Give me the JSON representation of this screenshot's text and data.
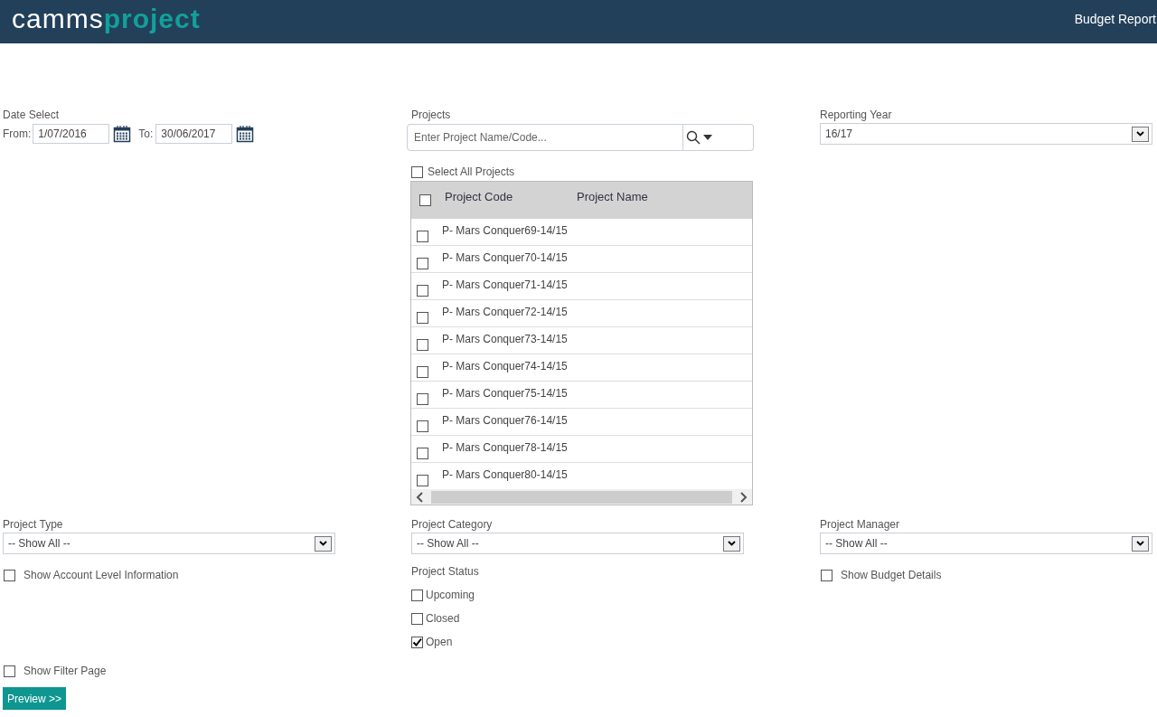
{
  "header": {
    "logo": {
      "part_1": "camms",
      "part_2": "project"
    },
    "title": "Budget Report"
  },
  "date_select": {
    "label": "Date Select",
    "from_label": "From:",
    "from_value": "1/07/2016",
    "to_label": "To:",
    "to_value": "30/06/2017"
  },
  "projects": {
    "label": "Projects",
    "placeholder": "Enter Project Name/Code...",
    "select_all": {
      "label": "Select All Projects",
      "checked": false
    },
    "table": {
      "header_checked": false,
      "columns": [
        "Project Code",
        "Project Name"
      ],
      "rows": [
        {
          "code": "P- Mars Conquer69-14/15",
          "checked": false
        },
        {
          "code": "P- Mars Conquer70-14/15",
          "checked": false
        },
        {
          "code": "P- Mars Conquer71-14/15",
          "checked": false
        },
        {
          "code": "P- Mars Conquer72-14/15",
          "checked": false
        },
        {
          "code": "P- Mars Conquer73-14/15",
          "checked": false
        },
        {
          "code": "P- Mars Conquer74-14/15",
          "checked": false
        },
        {
          "code": "P- Mars Conquer75-14/15",
          "checked": false
        },
        {
          "code": "P- Mars Conquer76-14/15",
          "checked": false
        },
        {
          "code": "P- Mars Conquer78-14/15",
          "checked": false
        },
        {
          "code": "P- Mars Conquer80-14/15",
          "checked": false
        }
      ]
    }
  },
  "reporting_year": {
    "label": "Reporting Year",
    "value": "16/17"
  },
  "project_type": {
    "label": "Project Type",
    "value": "-- Show All --"
  },
  "project_category": {
    "label": "Project Category",
    "value": "-- Show All --"
  },
  "project_manager": {
    "label": "Project Manager",
    "value": "-- Show All --"
  },
  "show_account_level": {
    "label": "Show Account Level Information",
    "checked": false
  },
  "project_status": {
    "label": "Project Status",
    "options": [
      {
        "label": "Upcoming",
        "checked": false
      },
      {
        "label": "Closed",
        "checked": false
      },
      {
        "label": "Open",
        "checked": true
      }
    ]
  },
  "show_budget_details": {
    "label": "Show Budget Details",
    "checked": false
  },
  "show_filter_page": {
    "label": "Show Filter Page",
    "checked": false
  },
  "preview_button": "Preview >>"
}
